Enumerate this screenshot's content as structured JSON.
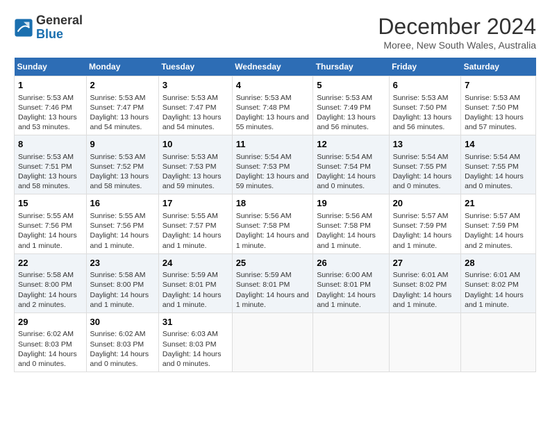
{
  "header": {
    "logo_line1": "General",
    "logo_line2": "Blue",
    "month": "December 2024",
    "location": "Moree, New South Wales, Australia"
  },
  "weekdays": [
    "Sunday",
    "Monday",
    "Tuesday",
    "Wednesday",
    "Thursday",
    "Friday",
    "Saturday"
  ],
  "weeks": [
    [
      {
        "day": 1,
        "sunrise": "5:53 AM",
        "sunset": "7:46 PM",
        "daylight": "13 hours and 53 minutes."
      },
      {
        "day": 2,
        "sunrise": "5:53 AM",
        "sunset": "7:47 PM",
        "daylight": "13 hours and 54 minutes."
      },
      {
        "day": 3,
        "sunrise": "5:53 AM",
        "sunset": "7:47 PM",
        "daylight": "13 hours and 54 minutes."
      },
      {
        "day": 4,
        "sunrise": "5:53 AM",
        "sunset": "7:48 PM",
        "daylight": "13 hours and 55 minutes."
      },
      {
        "day": 5,
        "sunrise": "5:53 AM",
        "sunset": "7:49 PM",
        "daylight": "13 hours and 56 minutes."
      },
      {
        "day": 6,
        "sunrise": "5:53 AM",
        "sunset": "7:50 PM",
        "daylight": "13 hours and 56 minutes."
      },
      {
        "day": 7,
        "sunrise": "5:53 AM",
        "sunset": "7:50 PM",
        "daylight": "13 hours and 57 minutes."
      }
    ],
    [
      {
        "day": 8,
        "sunrise": "5:53 AM",
        "sunset": "7:51 PM",
        "daylight": "13 hours and 58 minutes."
      },
      {
        "day": 9,
        "sunrise": "5:53 AM",
        "sunset": "7:52 PM",
        "daylight": "13 hours and 58 minutes."
      },
      {
        "day": 10,
        "sunrise": "5:53 AM",
        "sunset": "7:53 PM",
        "daylight": "13 hours and 59 minutes."
      },
      {
        "day": 11,
        "sunrise": "5:54 AM",
        "sunset": "7:53 PM",
        "daylight": "13 hours and 59 minutes."
      },
      {
        "day": 12,
        "sunrise": "5:54 AM",
        "sunset": "7:54 PM",
        "daylight": "14 hours and 0 minutes."
      },
      {
        "day": 13,
        "sunrise": "5:54 AM",
        "sunset": "7:55 PM",
        "daylight": "14 hours and 0 minutes."
      },
      {
        "day": 14,
        "sunrise": "5:54 AM",
        "sunset": "7:55 PM",
        "daylight": "14 hours and 0 minutes."
      }
    ],
    [
      {
        "day": 15,
        "sunrise": "5:55 AM",
        "sunset": "7:56 PM",
        "daylight": "14 hours and 1 minute."
      },
      {
        "day": 16,
        "sunrise": "5:55 AM",
        "sunset": "7:56 PM",
        "daylight": "14 hours and 1 minute."
      },
      {
        "day": 17,
        "sunrise": "5:55 AM",
        "sunset": "7:57 PM",
        "daylight": "14 hours and 1 minute."
      },
      {
        "day": 18,
        "sunrise": "5:56 AM",
        "sunset": "7:58 PM",
        "daylight": "14 hours and 1 minute."
      },
      {
        "day": 19,
        "sunrise": "5:56 AM",
        "sunset": "7:58 PM",
        "daylight": "14 hours and 1 minute."
      },
      {
        "day": 20,
        "sunrise": "5:57 AM",
        "sunset": "7:59 PM",
        "daylight": "14 hours and 1 minute."
      },
      {
        "day": 21,
        "sunrise": "5:57 AM",
        "sunset": "7:59 PM",
        "daylight": "14 hours and 2 minutes."
      }
    ],
    [
      {
        "day": 22,
        "sunrise": "5:58 AM",
        "sunset": "8:00 PM",
        "daylight": "14 hours and 2 minutes."
      },
      {
        "day": 23,
        "sunrise": "5:58 AM",
        "sunset": "8:00 PM",
        "daylight": "14 hours and 1 minute."
      },
      {
        "day": 24,
        "sunrise": "5:59 AM",
        "sunset": "8:01 PM",
        "daylight": "14 hours and 1 minute."
      },
      {
        "day": 25,
        "sunrise": "5:59 AM",
        "sunset": "8:01 PM",
        "daylight": "14 hours and 1 minute."
      },
      {
        "day": 26,
        "sunrise": "6:00 AM",
        "sunset": "8:01 PM",
        "daylight": "14 hours and 1 minute."
      },
      {
        "day": 27,
        "sunrise": "6:01 AM",
        "sunset": "8:02 PM",
        "daylight": "14 hours and 1 minute."
      },
      {
        "day": 28,
        "sunrise": "6:01 AM",
        "sunset": "8:02 PM",
        "daylight": "14 hours and 1 minute."
      }
    ],
    [
      {
        "day": 29,
        "sunrise": "6:02 AM",
        "sunset": "8:03 PM",
        "daylight": "14 hours and 0 minutes."
      },
      {
        "day": 30,
        "sunrise": "6:02 AM",
        "sunset": "8:03 PM",
        "daylight": "14 hours and 0 minutes."
      },
      {
        "day": 31,
        "sunrise": "6:03 AM",
        "sunset": "8:03 PM",
        "daylight": "14 hours and 0 minutes."
      },
      null,
      null,
      null,
      null
    ]
  ]
}
